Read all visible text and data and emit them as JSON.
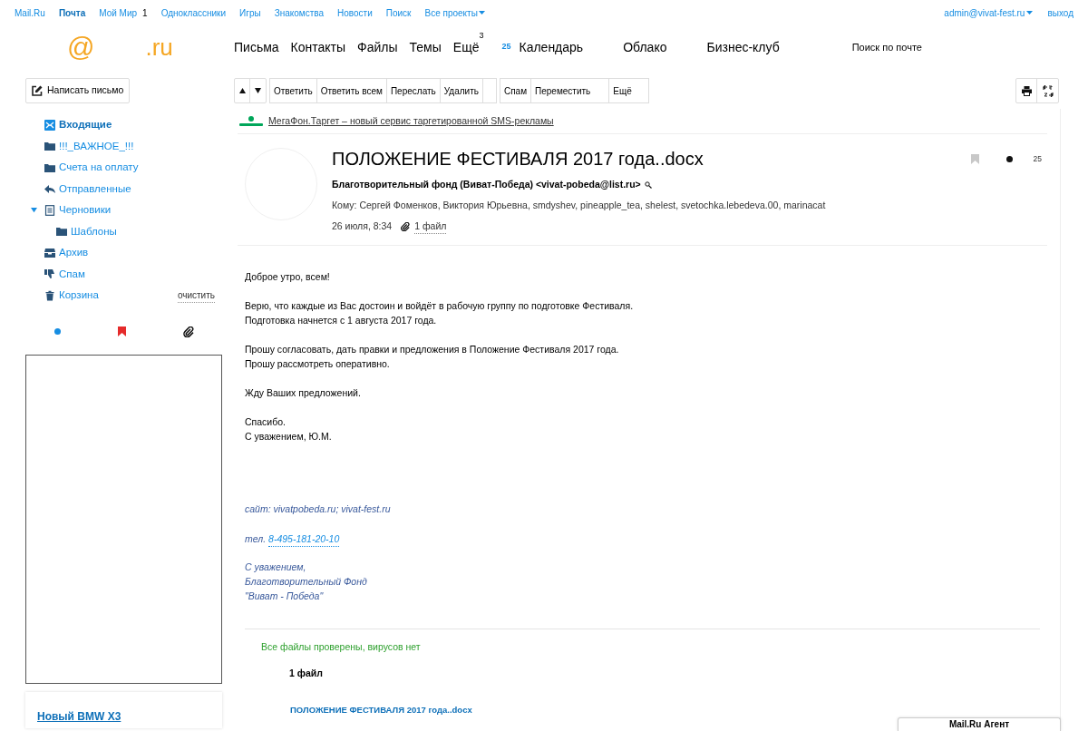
{
  "top_links": [
    {
      "label": "Mail.Ru",
      "selected": false
    },
    {
      "label": "Почта",
      "selected": true
    },
    {
      "label": "Мой Мир",
      "selected": false,
      "badge": "1"
    },
    {
      "label": "Одноклассники",
      "selected": false
    },
    {
      "label": "Игры",
      "selected": false
    },
    {
      "label": "Знакомства",
      "selected": false
    },
    {
      "label": "Новости",
      "selected": false
    },
    {
      "label": "Поиск",
      "selected": false
    },
    {
      "label": "Все проекты",
      "selected": false,
      "dropdown": true
    }
  ],
  "account": {
    "email": "admin@vivat-fest.ru",
    "logout": "выход"
  },
  "logo": {
    "mark": "@",
    "domain": ".ru"
  },
  "nav": [
    {
      "label": "Письма"
    },
    {
      "label": "Контакты"
    },
    {
      "label": "Файлы"
    },
    {
      "label": "Темы"
    },
    {
      "label": "Ещё",
      "badge": "3"
    },
    {
      "label": "Календарь",
      "day": "25"
    },
    {
      "label": "Облако"
    },
    {
      "label": "Бизнес-клуб"
    }
  ],
  "search": {
    "placeholder": "Поиск по почте"
  },
  "compose": "Написать письмо",
  "toolbar": [
    {
      "kind": "text",
      "label": "Ответить"
    },
    {
      "kind": "text",
      "label": "Ответить всем"
    },
    {
      "kind": "text",
      "label": "Переслать"
    },
    {
      "kind": "text",
      "label": "Удалить"
    },
    {
      "kind": "blank"
    },
    {
      "kind": "text",
      "label": "Спам"
    },
    {
      "kind": "text",
      "label": "Переместить"
    },
    {
      "kind": "text",
      "label": "Ещё"
    }
  ],
  "folders": [
    {
      "name": "Входящие",
      "kind": "inbox",
      "selected": true
    },
    {
      "name": "!!!_ВАЖНОЕ_!!!",
      "kind": "folder",
      "selected": false
    },
    {
      "name": "Счета на оплату",
      "kind": "folder",
      "selected": false
    },
    {
      "name": "Отправленные",
      "kind": "sent",
      "selected": false
    },
    {
      "name": "Черновики",
      "kind": "drafts",
      "selected": false,
      "expanded": true,
      "children": [
        {
          "name": "Шаблоны",
          "kind": "folder",
          "selected": false
        }
      ]
    },
    {
      "name": "Архив",
      "kind": "archive",
      "selected": false
    },
    {
      "name": "Спам",
      "kind": "spam",
      "selected": false
    },
    {
      "name": "Корзина",
      "kind": "trash",
      "selected": false,
      "action": "очистить"
    }
  ],
  "ad": {
    "title": "Новый BMW X3"
  },
  "banner": {
    "text": "МегаФон.Таргет – новый сервис таргетированной SMS-рекламы"
  },
  "message": {
    "subject": "ПОЛОЖЕНИЕ ФЕСТИВАЛЯ 2017 года..docx",
    "from": "Благотворительный фонд (Виват-Победа) <vivat-pobeda@list.ru>",
    "to": "Кому: Сергей Фоменков, Виктория Юрьевна, smdyshev, pineapple_tea, shelest, svetochka.lebedeva.00, marinacat",
    "date": "26 июля, 8:34",
    "attachments_link": "1 файл",
    "flagged": false,
    "unread": true,
    "day": "25",
    "body": [
      [
        "Доброе утро, всем!"
      ],
      [
        "Верю, что каждые из Вас достоин и войдёт в рабочую группу по подготовке Фестиваля.",
        "Подготовка начнется с 1 августа 2017 года."
      ],
      [
        "Прошу согласовать, дать правки и предложения в Положение Фестиваля 2017 года.",
        "Прошу рассмотреть оперативно."
      ],
      [
        "Жду Ваших предложений."
      ],
      [
        "Спасибо.",
        "С уважением, Ю.М."
      ]
    ],
    "signature": {
      "site": "сайт: vivatpobeda.ru; vivat-fest.ru",
      "phone_label": "тел.",
      "phone": "8-495-181-20-10",
      "closing": [
        "С уважением,",
        "Благотворительный Фонд",
        "\"Виват - Победа\""
      ]
    },
    "scan": "Все файлы проверены, вирусов нет",
    "files_count": "1 файл",
    "files": [
      {
        "name": "ПОЛОЖЕНИЕ ФЕСТИВАЛЯ 2017 года..docx"
      }
    ]
  },
  "agent": {
    "title": "Mail.Ru Агент"
  }
}
